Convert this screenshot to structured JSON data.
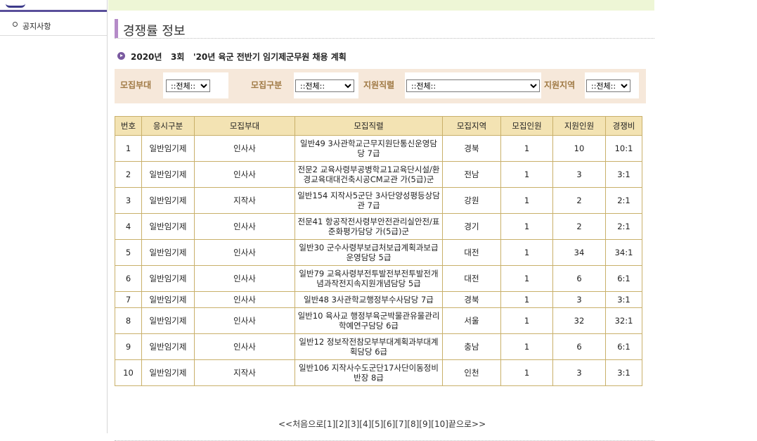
{
  "sidebar": {
    "items": [
      {
        "label": "공지사항"
      }
    ]
  },
  "page": {
    "title": "경쟁률 정보",
    "subtitle": "2020년   3회   '20년 육군 전반기 임기제군무원 채용 계획"
  },
  "filters": [
    {
      "label": "모집부대",
      "value": "::전체::"
    },
    {
      "label": "모집구분",
      "value": "::전체::"
    },
    {
      "label": "지원직렬",
      "value": "::전체::"
    },
    {
      "label": "지원지역",
      "value": "::전체::"
    }
  ],
  "table": {
    "headers": [
      "번호",
      "응시구분",
      "모집부대",
      "모집직렬",
      "모집지역",
      "모집인원",
      "지원인원",
      "경쟁비"
    ],
    "rows": [
      [
        "1",
        "일반임기제",
        "인사사",
        "일반49 3사관학교근무지원단통신운영담당 7급",
        "경북",
        "1",
        "10",
        "10:1"
      ],
      [
        "2",
        "일반임기제",
        "인사사",
        "전문2 교육사령부공병학교1교육단시설/환경교육대대건축시공CM교관 가(5급)군",
        "전남",
        "1",
        "3",
        "3:1"
      ],
      [
        "3",
        "일반임기제",
        "지작사",
        "일반154 지작사5군단 3사단양성평등상담관 7급",
        "강원",
        "1",
        "2",
        "2:1"
      ],
      [
        "4",
        "일반임기제",
        "인사사",
        "전문41 항공작전사령부안전관리실안전/표준화평가담당 가(5급)군",
        "경기",
        "1",
        "2",
        "2:1"
      ],
      [
        "5",
        "일반임기제",
        "인사사",
        "일반30 군수사령부보급처보급계획과보급운영담당 5급",
        "대전",
        "1",
        "34",
        "34:1"
      ],
      [
        "6",
        "일반임기제",
        "인사사",
        "일반79 교육사령부전투발전부전투발전개념과작전지속지원개념담당 5급",
        "대전",
        "1",
        "6",
        "6:1"
      ],
      [
        "7",
        "일반임기제",
        "인사사",
        "일반48 3사관학교행정부수사담당 7급",
        "경북",
        "1",
        "3",
        "3:1"
      ],
      [
        "8",
        "일반임기제",
        "인사사",
        "일반10 육사교 행정부육군박물관유물관리학예연구담당 6급",
        "서울",
        "1",
        "32",
        "32:1"
      ],
      [
        "9",
        "일반임기제",
        "인사사",
        "일반12 정보작전참모부부대계획과부대계획담당 6급",
        "충남",
        "1",
        "6",
        "6:1"
      ],
      [
        "10",
        "일반임기제",
        "지작사",
        "일반106 지작사수도군단17사단이동정비반장 8급",
        "인천",
        "1",
        "3",
        "3:1"
      ]
    ]
  },
  "pagination": {
    "first": "<<처음으로",
    "pages": [
      "[1]",
      "[2]",
      "[3]",
      "[4]",
      "[5]",
      "[6]",
      "[7]",
      "[8]",
      "[9]",
      "[10]"
    ],
    "last": "끝으로>>"
  }
}
